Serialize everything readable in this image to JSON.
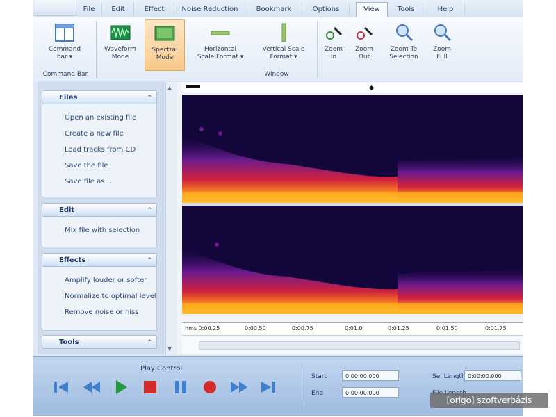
{
  "ribbon_tabs": [
    {
      "label": "File"
    },
    {
      "label": "Edit"
    },
    {
      "label": "Effect"
    },
    {
      "label": "Noise Reduction"
    },
    {
      "label": "Bookmark"
    },
    {
      "label": "Options"
    },
    {
      "label": "View"
    },
    {
      "label": "Tools"
    },
    {
      "label": "Help"
    }
  ],
  "active_tab": "View",
  "ribbon": {
    "command_bar": {
      "label1": "Command",
      "label2": "bar",
      "group": "Command Bar"
    },
    "waveform_mode": {
      "label1": "Waveform",
      "label2": "Mode"
    },
    "spectral_mode": {
      "label1": "Spectral",
      "label2": "Mode"
    },
    "h_scale": {
      "label1": "Horizontal",
      "label2": "Scale Format"
    },
    "v_scale": {
      "label1": "Vertical Scale",
      "label2": "Format"
    },
    "window_group": "Window",
    "zoom_in": {
      "label1": "Zoom",
      "label2": "In"
    },
    "zoom_out": {
      "label1": "Zoom",
      "label2": "Out"
    },
    "zoom_sel": {
      "label1": "Zoom To",
      "label2": "Selection"
    },
    "zoom_full": {
      "label1": "Zoom",
      "label2": "Full"
    }
  },
  "sidebar": {
    "files": {
      "title": "Files",
      "items": [
        "Open an existing file",
        "Create a new file",
        "Load tracks from CD",
        "Save the file",
        "Save file as..."
      ]
    },
    "edit": {
      "title": "Edit",
      "items": [
        "Mix file with selection"
      ]
    },
    "effects": {
      "title": "Effects",
      "items": [
        "Amplify louder or softer",
        "Normalize to optimal level",
        "Remove noise or hiss"
      ]
    },
    "tools": {
      "title": "Tools"
    }
  },
  "timeline": {
    "ticks": [
      "hms 0:00.25",
      "0:00.50",
      "0:00.75",
      "0:01.0",
      "0:01.25",
      "0:01.50",
      "0:01.75"
    ]
  },
  "player": {
    "title": "Play Control",
    "start_label": "Start",
    "start_value": "0:00:00.000",
    "end_label": "End",
    "end_value": "0:00:00.000",
    "sel_length_label": "Sel Length",
    "sel_length_value": "0:00:00.000",
    "file_length_label": "File Length"
  },
  "watermark": "[origo] szoftverbázis",
  "colors": {
    "accent": "#f8c98a",
    "spectrogram_bg": "#12063a",
    "player_bg": "#a9c2e3"
  }
}
